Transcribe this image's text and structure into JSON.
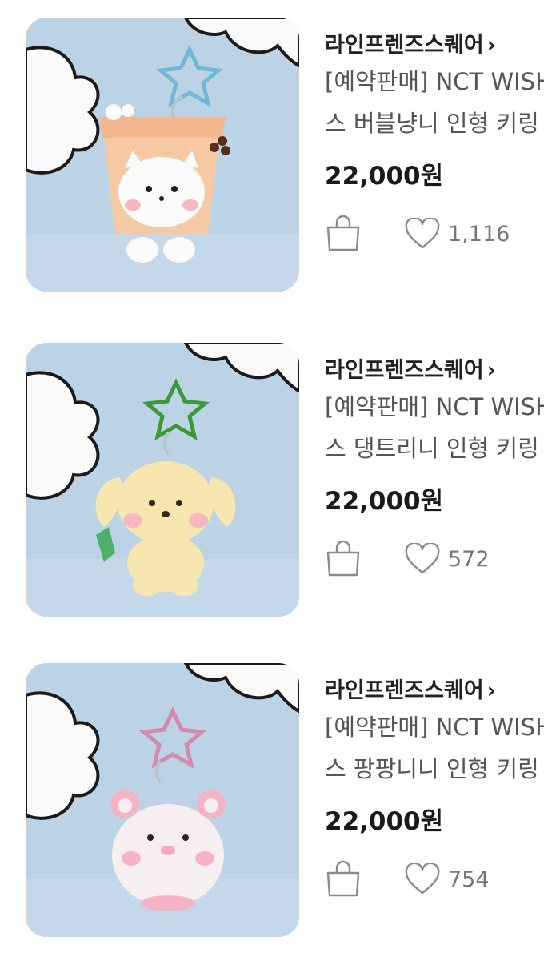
{
  "products": [
    {
      "brand": "라인프렌즈스퀘어",
      "chevron": "›",
      "title_line1": "[예약판매] NCT WISH",
      "title_line2": "스 버블냥니 인형 키링",
      "price": "22,000원",
      "likes": "1,116",
      "image": {
        "item": "bubble-tea-cat-plush-keyring",
        "carabiner_color": "#6fb8d8",
        "plush_color": "#f4c9a4"
      },
      "cart_icon": "shopping-bag-icon",
      "like_icon": "heart-outline-icon"
    },
    {
      "brand": "라인프렌즈스퀘어",
      "chevron": "›",
      "title_line1": "[예약판매] NCT WISH",
      "title_line2": "스 댕트리니 인형 키링",
      "price": "22,000원",
      "likes": "572",
      "image": {
        "item": "puppy-plush-keyring",
        "carabiner_color": "#3a9a3a",
        "plush_color": "#f8e6b0"
      },
      "cart_icon": "shopping-bag-icon",
      "like_icon": "heart-outline-icon"
    },
    {
      "brand": "라인프렌즈스퀘어",
      "chevron": "›",
      "title_line1": "[예약판매] NCT WISH",
      "title_line2": "스 팡팡니니 인형 키링",
      "price": "22,000원",
      "likes": "754",
      "image": {
        "item": "pink-bear-plush-keyring",
        "carabiner_color": "#d48aa8",
        "plush_color": "#f6eef1"
      },
      "cart_icon": "shopping-bag-icon",
      "like_icon": "heart-outline-icon"
    }
  ]
}
